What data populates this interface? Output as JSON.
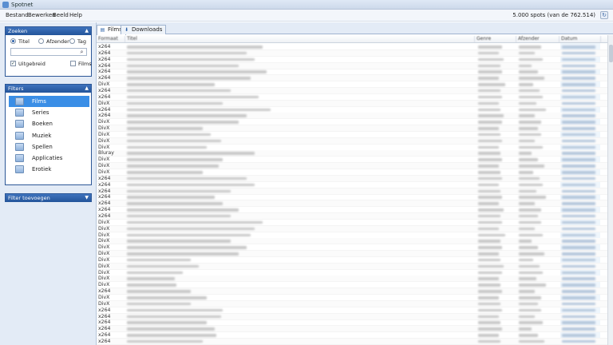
{
  "window": {
    "title": "Spotnet"
  },
  "menu": {
    "items": [
      "Bestand",
      "Bewerken",
      "Beeld",
      "Help"
    ],
    "spot_count": "5.000 spots (van de 762.514)"
  },
  "search": {
    "header": "Zoeken",
    "options": [
      "Titel",
      "Afzender",
      "Tag"
    ],
    "selected": "Titel",
    "query": "",
    "uitgebreid_label": "Uitgebreid",
    "uitgebreid_checked": true,
    "films_label": "Films",
    "films_checked": false
  },
  "filters": {
    "header": "Filters",
    "items": [
      "Films",
      "Series",
      "Boeken",
      "Muziek",
      "Spellen",
      "Applicaties",
      "Erotiek"
    ],
    "selected": "Films"
  },
  "add_filter": {
    "header": "Filter toevoegen"
  },
  "tabs": [
    {
      "label": "Films",
      "icon": "list-icon",
      "selected": true
    },
    {
      "label": "Downloads",
      "icon": "download-icon",
      "selected": false
    }
  ],
  "grid": {
    "columns": [
      "Formaat",
      "Titel",
      "Genre",
      "Afzender",
      "Datum"
    ],
    "rows": [
      {
        "format": "x264"
      },
      {
        "format": "x264"
      },
      {
        "format": "x264"
      },
      {
        "format": "x264"
      },
      {
        "format": "x264"
      },
      {
        "format": "x264"
      },
      {
        "format": "DivX"
      },
      {
        "format": "x264"
      },
      {
        "format": "x264"
      },
      {
        "format": "DivX"
      },
      {
        "format": "x264"
      },
      {
        "format": "x264"
      },
      {
        "format": "DivX"
      },
      {
        "format": "DivX"
      },
      {
        "format": "DivX"
      },
      {
        "format": "DivX"
      },
      {
        "format": "DivX"
      },
      {
        "format": "Bluray"
      },
      {
        "format": "DivX"
      },
      {
        "format": "DivX"
      },
      {
        "format": "DivX"
      },
      {
        "format": "x264"
      },
      {
        "format": "x264"
      },
      {
        "format": "x264"
      },
      {
        "format": "x264"
      },
      {
        "format": "x264"
      },
      {
        "format": "x264"
      },
      {
        "format": "x264"
      },
      {
        "format": "DivX"
      },
      {
        "format": "DivX"
      },
      {
        "format": "DivX"
      },
      {
        "format": "DivX"
      },
      {
        "format": "DivX"
      },
      {
        "format": "DivX"
      },
      {
        "format": "DivX"
      },
      {
        "format": "DivX"
      },
      {
        "format": "DivX"
      },
      {
        "format": "DivX"
      },
      {
        "format": "DivX"
      },
      {
        "format": "x264"
      },
      {
        "format": "DivX"
      },
      {
        "format": "DivX"
      },
      {
        "format": "x264"
      },
      {
        "format": "x264"
      },
      {
        "format": "x264"
      },
      {
        "format": "x264"
      },
      {
        "format": "x264"
      },
      {
        "format": "x264"
      }
    ]
  }
}
